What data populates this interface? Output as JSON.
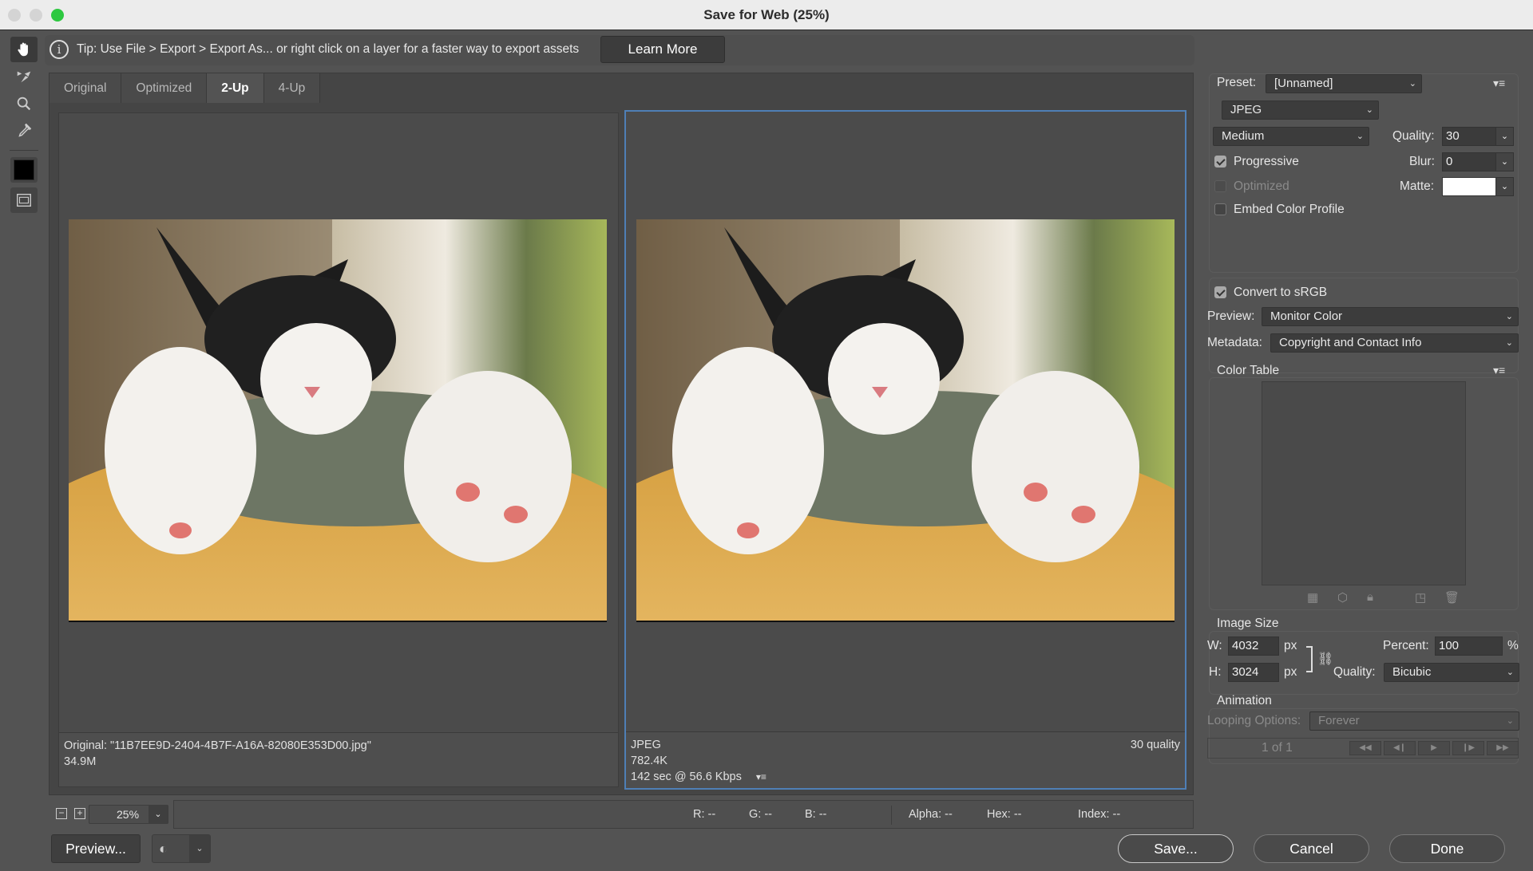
{
  "window": {
    "title": "Save for Web (25%)",
    "traffic_lights": {
      "close": "#d0d0d0",
      "minimize": "#d0d0d0",
      "zoom": "#2dc840"
    }
  },
  "tools": [
    {
      "name": "hand-tool",
      "icon": "hand-icon",
      "active": true
    },
    {
      "name": "slice-select-tool",
      "icon": "slice-select-icon",
      "active": false
    },
    {
      "name": "zoom-tool",
      "icon": "magnifier-icon",
      "active": false
    },
    {
      "name": "eyedropper-tool",
      "icon": "eyedropper-icon",
      "active": false
    },
    {
      "name": "eyedropper-color",
      "icon": "color-swatch-icon",
      "color": "#000000"
    },
    {
      "name": "toggle-slices-visibility",
      "icon": "slices-visibility-icon",
      "active": false
    }
  ],
  "tip": {
    "icon": "info-icon",
    "icon_glyph": "i",
    "text": "Tip: Use File > Export > Export As...  or right click on a layer for a faster way to export assets",
    "button_label": "Learn More"
  },
  "tabs": [
    {
      "label": "Original",
      "active": false
    },
    {
      "label": "Optimized",
      "active": false
    },
    {
      "label": "2-Up",
      "active": true
    },
    {
      "label": "4-Up",
      "active": false
    }
  ],
  "panels": {
    "original": {
      "line1": "Original: \"11B7EE9D-2404-4B7F-A16A-82080E353D00.jpg\"",
      "line2": "34.9M"
    },
    "optimized": {
      "format": "JPEG",
      "size": "782.4K",
      "download_time": "142 sec @ 56.6 Kbps",
      "quality_label": "30 quality",
      "selected_border_color": "#4f7fb6"
    }
  },
  "zoom": {
    "minus": "−",
    "plus": "+",
    "value": "25%",
    "chevron": "⌄"
  },
  "readout": {
    "r": "R: --",
    "g": "G: --",
    "b": "B: --",
    "alpha": "Alpha: --",
    "hex": "Hex: --",
    "index": "Index: --"
  },
  "footer": {
    "preview_label": "Preview...",
    "save_label": "Save...",
    "cancel_label": "Cancel",
    "done_label": "Done"
  },
  "settings": {
    "preset_label": "Preset:",
    "preset_value": "[Unnamed]",
    "format_value": "JPEG",
    "compression_value": "Medium",
    "quality_label": "Quality:",
    "quality_value": "30",
    "blur_label": "Blur:",
    "blur_value": "0",
    "matte_label": "Matte:",
    "matte_color": "#ffffff",
    "progressive_label": "Progressive",
    "progressive_checked": true,
    "optimized_label": "Optimized",
    "optimized_checked": false,
    "embed_profile_label": "Embed Color Profile",
    "embed_profile_checked": false,
    "convert_srgb_label": "Convert to sRGB",
    "convert_srgb_checked": true,
    "preview_label": "Preview:",
    "preview_value": "Monitor Color",
    "metadata_label": "Metadata:",
    "metadata_value": "Copyright and Contact Info",
    "color_table_label": "Color Table",
    "color_table_icons": [
      "transparency-icon",
      "web-shift-icon",
      "lock-icon",
      "new-color-icon",
      "trash-icon"
    ]
  },
  "image_size": {
    "title": "Image Size",
    "w_label": "W:",
    "w_value": "4032",
    "h_label": "H:",
    "h_value": "3024",
    "unit": "px",
    "percent_label": "Percent:",
    "percent_value": "100",
    "percent_unit": "%",
    "quality_label": "Quality:",
    "quality_value": "Bicubic"
  },
  "animation": {
    "title": "Animation",
    "looping_label": "Looping Options:",
    "looping_value": "Forever",
    "frame_counter": "1 of 1",
    "controls": [
      "◀◀",
      "◀❙",
      "▶",
      "❙▶",
      "▶▶"
    ]
  },
  "chevron": "⌄",
  "menu_glyph": "▾≡"
}
